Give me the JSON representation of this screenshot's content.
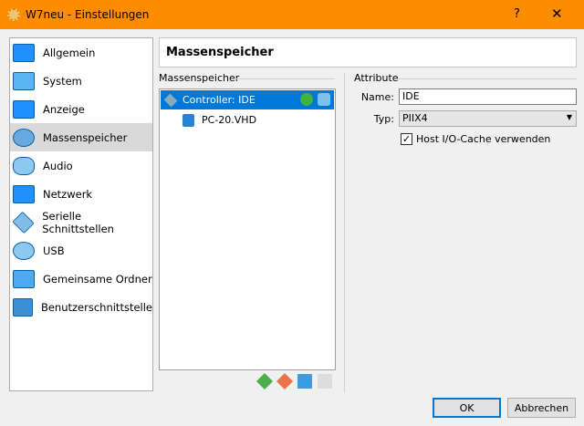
{
  "window": {
    "title": "W7neu - Einstellungen",
    "help": "?",
    "close": "✕"
  },
  "sidebar": {
    "items": [
      {
        "label": "Allgemein"
      },
      {
        "label": "System"
      },
      {
        "label": "Anzeige"
      },
      {
        "label": "Massenspeicher",
        "selected": true
      },
      {
        "label": "Audio"
      },
      {
        "label": "Netzwerk"
      },
      {
        "label": "Serielle Schnittstellen"
      },
      {
        "label": "USB"
      },
      {
        "label": "Gemeinsame Ordner"
      },
      {
        "label": "Benutzerschnittstelle"
      }
    ]
  },
  "header": {
    "title": "Massenspeicher"
  },
  "storage": {
    "group_label": "Massenspeicher",
    "controller": "Controller: IDE",
    "disk": "PC-20.VHD"
  },
  "attributes": {
    "group_label": "Attribute",
    "name_label": "Name:",
    "name_value": "IDE",
    "type_label": "Typ:",
    "type_value": "PIIX4",
    "cache_label": "Host I/O-Cache verwenden",
    "cache_checked": true
  },
  "buttons": {
    "ok": "OK",
    "cancel": "Abbrechen"
  }
}
